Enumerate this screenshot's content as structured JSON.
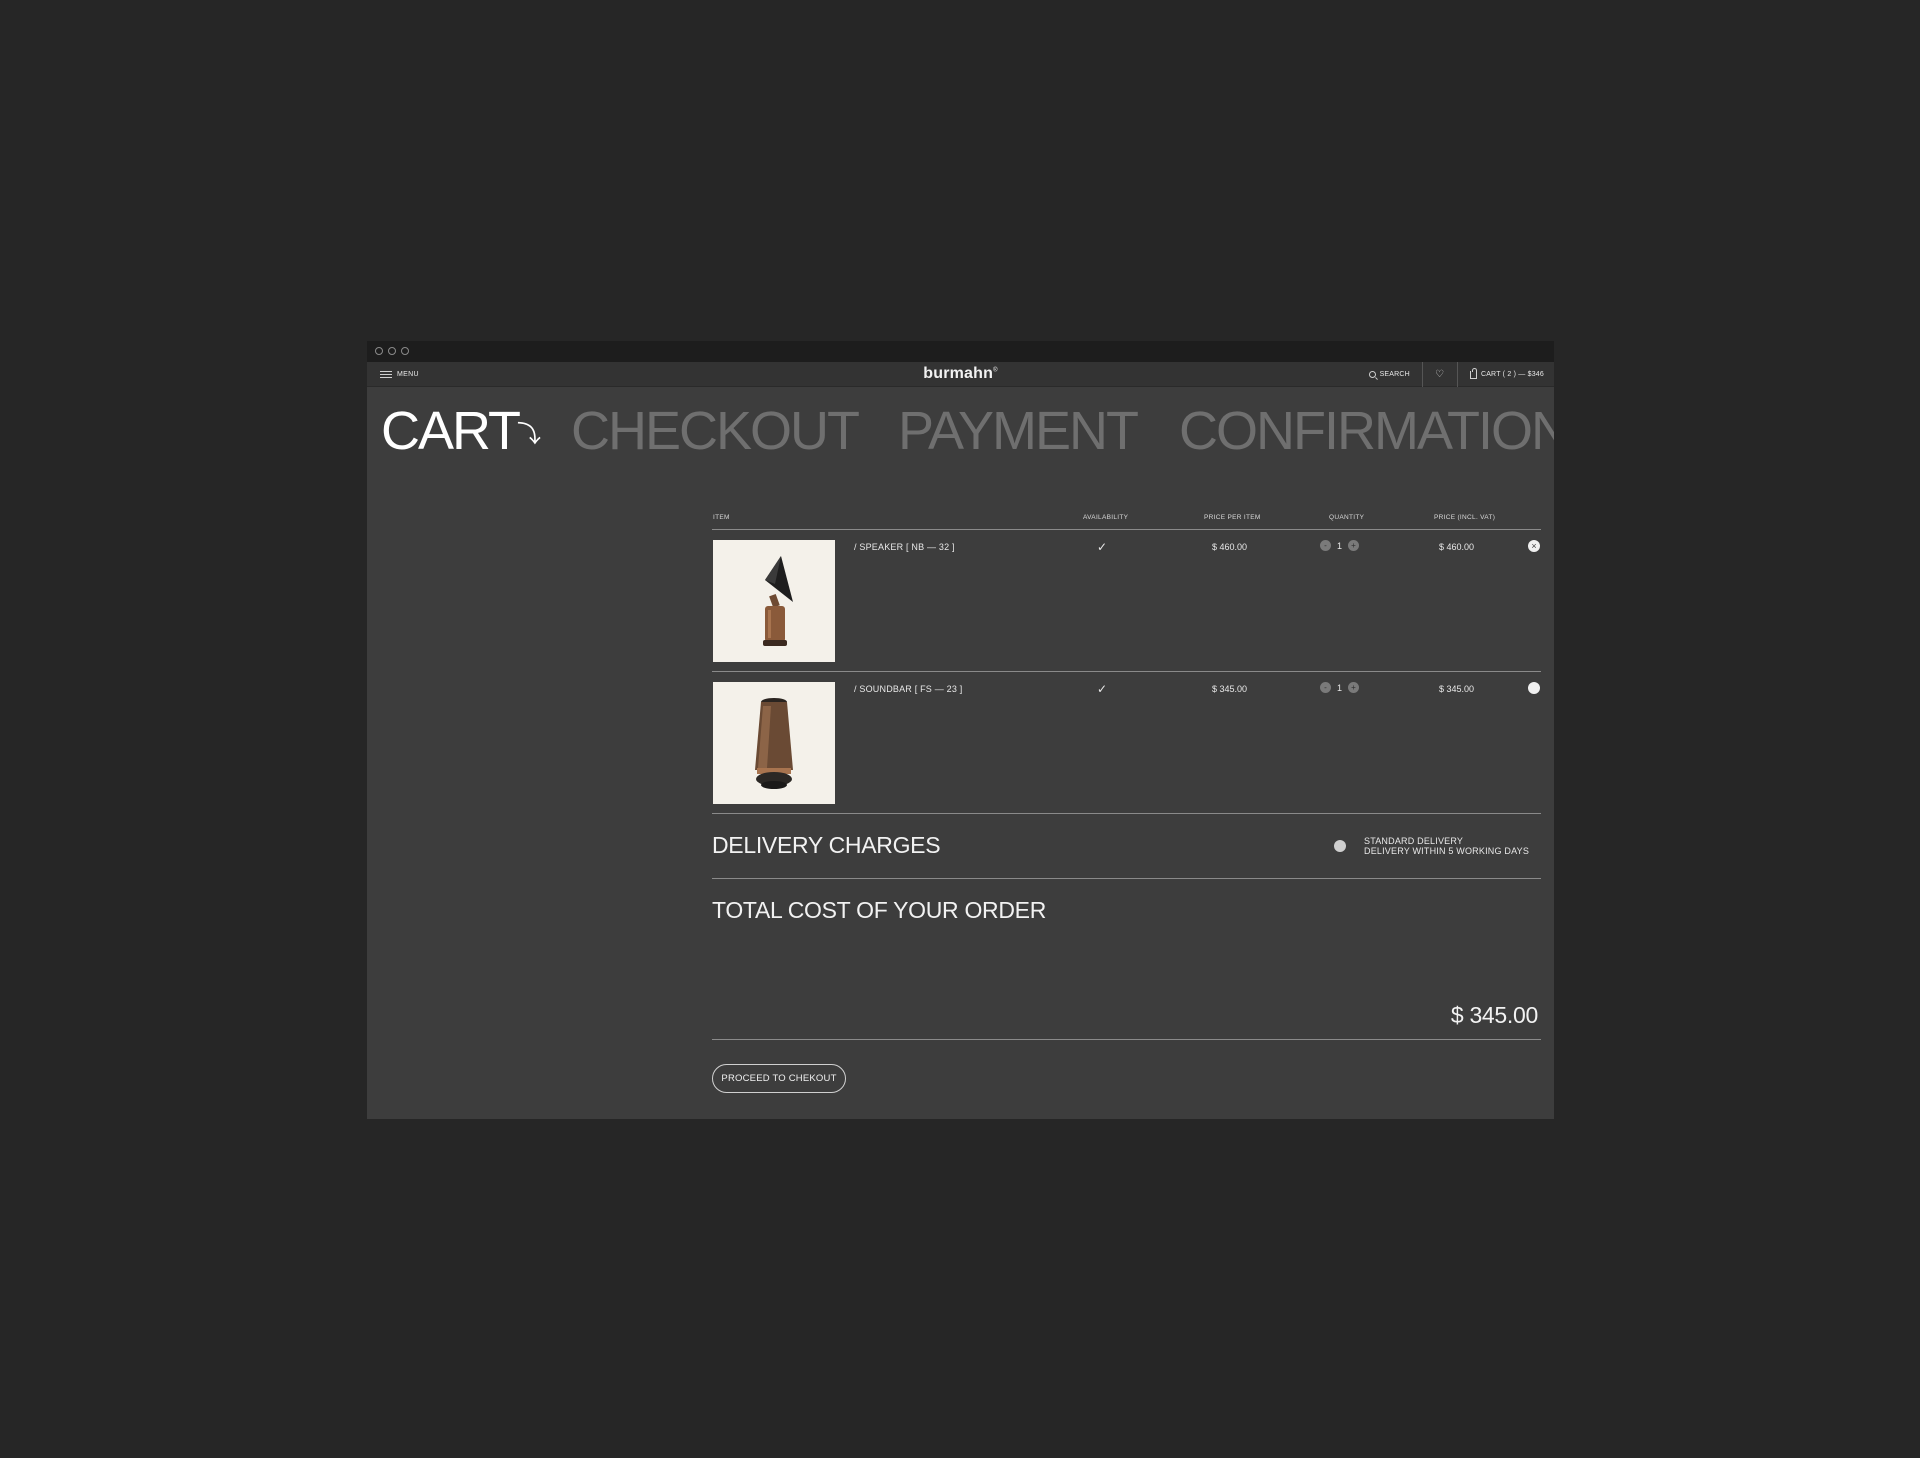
{
  "window": {
    "controls": [
      "close",
      "minimize",
      "maximize"
    ]
  },
  "nav": {
    "menu_label": "MENU",
    "brand": "burmahn",
    "brand_mark": "®",
    "search_label": "SEARCH",
    "cart_label": "CART ( 2 ) — $346"
  },
  "steps": {
    "cart": "CART",
    "cart_arrow": "⤵",
    "checkout": "CHECKOUT",
    "payment": "PAYMENT",
    "confirmation": "CONFIRMATION"
  },
  "table": {
    "headers": {
      "item": "ITEM",
      "availability": "AVAILABILITY",
      "price_per_item": "PRICE PER ITEM",
      "quantity": "QUANTITY",
      "price_incl_vat": "PRICE (INCL. VAT)"
    },
    "items": [
      {
        "name": "/ SPEAKER [ NB — 32 ]",
        "availability": "✓",
        "price_per_item": "$ 460.00",
        "quantity": "1",
        "price_incl_vat": "$ 460.00",
        "image_icon": "speaker-product-image"
      },
      {
        "name": "/ SOUNDBAR [ FS — 23 ]",
        "availability": "✓",
        "price_per_item": "$ 345.00",
        "quantity": "1",
        "price_incl_vat": "$ 345.00",
        "image_icon": "soundbar-product-image"
      }
    ],
    "qty_minus": "-",
    "qty_plus": "+",
    "remove_symbol": "×"
  },
  "delivery": {
    "title": "DELIVERY CHARGES",
    "option_line1": "STANDARD DELIVERY",
    "option_line2": "DELIVERY WITHIN 5 WORKING DAYS"
  },
  "total": {
    "title": "TOTAL COST OF YOUR ORDER",
    "amount": "$ 345.00"
  },
  "actions": {
    "proceed_label": "PROCEED TO CHEKOUT"
  },
  "colors": {
    "page_background": "#262626",
    "window_background": "#3d3d3d",
    "navbar_background": "#333333",
    "inactive_step": "#6f6f6f",
    "product_background": "#f4f1ea",
    "copper": "#8a5a3a"
  }
}
